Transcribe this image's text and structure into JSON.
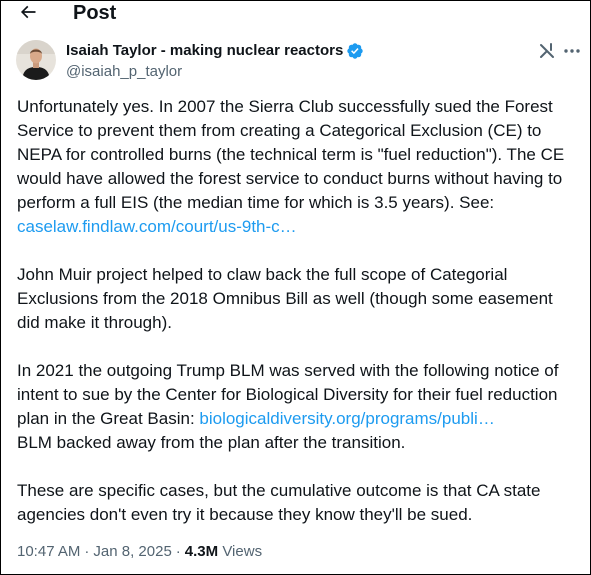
{
  "header": {
    "title": "Post",
    "back_icon": "arrow-left-icon"
  },
  "author": {
    "name": "Isaiah Taylor - making nuclear reactors",
    "handle": "@isaiah_p_taylor",
    "verified": true,
    "verified_color": "#1d9bf0"
  },
  "actions": {
    "grok_icon": "grok-icon",
    "more_icon": "more-horizontal-icon"
  },
  "tweet": {
    "p1_text": "Unfortunately yes. In 2007 the Sierra Club successfully sued the Forest Service to prevent them from creating a Categorical Exclusion (CE) to NEPA for controlled burns (the technical term is \"fuel reduction\"). The CE would have allowed the forest service to conduct burns without having to perform a full EIS (the median time for which is 3.5 years). See:",
    "p1_link": "caselaw.findlaw.com/court/us-9th-c…",
    "p2_text": "John Muir project helped to claw back the full scope of Categorial Exclusions from the 2018 Omnibus Bill as well (though some easement did make it through).",
    "p3_text": "In 2021 the outgoing Trump BLM was served with the following notice of intent to sue by the Center for Biological Diversity for their fuel reduction plan in the Great Basin: ",
    "p3_link": "biologicaldiversity.org/programs/publi…",
    "p3_after": "BLM backed away from the plan after the transition.",
    "p4_text": "These are specific cases, but the cumulative outcome is that CA state agencies don't even try it because they know they'll be sued."
  },
  "meta": {
    "time": "10:47 AM",
    "separator": "·",
    "date": "Jan 8, 2025",
    "views_count": "4.3M",
    "views_label": "Views"
  },
  "colors": {
    "text": "#0f1419",
    "secondary": "#536471",
    "link": "#1d9bf0"
  }
}
